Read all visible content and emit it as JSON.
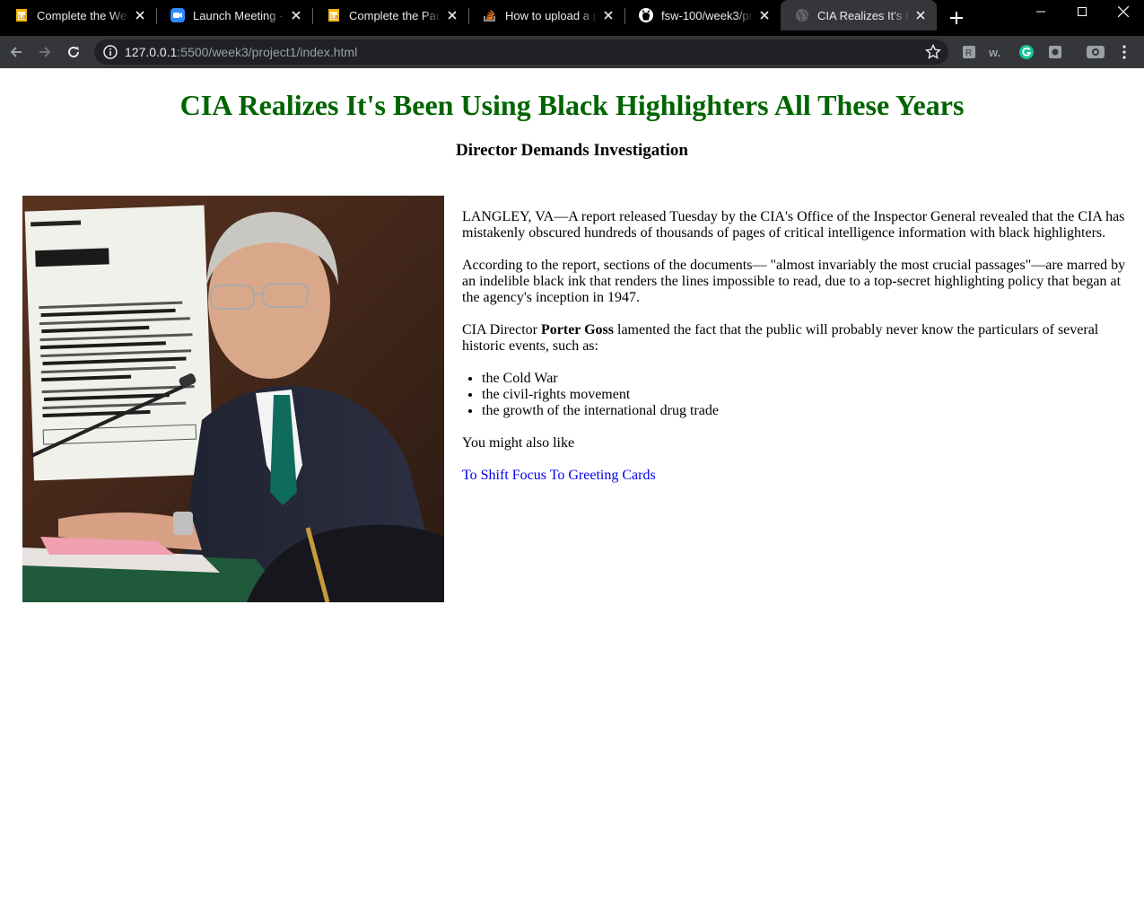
{
  "browser": {
    "tabs": [
      {
        "title": "Complete the Week 3",
        "favicon": "lambda-doc-icon",
        "active": false
      },
      {
        "title": "Launch Meeting - Zoom",
        "favicon": "zoom-icon",
        "active": false
      },
      {
        "title": "Complete the Pause",
        "favicon": "lambda-doc-icon",
        "active": false
      },
      {
        "title": "How to upload a pro",
        "favicon": "stackoverflow-icon",
        "active": false
      },
      {
        "title": "fsw-100/week3/proje",
        "favicon": "github-icon",
        "active": false
      },
      {
        "title": "CIA Realizes It's Been",
        "favicon": "globe-icon",
        "active": true
      }
    ],
    "address": {
      "host": "127.0.0.1",
      "rest": ":5500/week3/project1/index.html"
    },
    "colors": {
      "tabbar": "#000000",
      "toolbar": "#35363a",
      "omnibox": "#202124",
      "text": "#e8eaed"
    }
  },
  "article": {
    "headline": "CIA Realizes It's Been Using Black Highlighters All These Years",
    "subheadline": "Director Demands Investigation",
    "headline_color": "#006400",
    "paragraph1": "LANGLEY, VA—A report released Tuesday by the CIA's Office of the Inspector General revealed that the CIA has mistakenly obscured hundreds of thousands of pages of critical intelligence information with black highlighters.",
    "paragraph2": "According to the report, sections of the documents— \"almost invariably the most crucial passages\"—are marred by an indelible black ink that renders the lines impossible to read, due to a top-secret highlighting policy that began at the agency's inception in 1947.",
    "paragraph3_before": "CIA Director ",
    "paragraph3_bold": "Porter Goss",
    "paragraph3_after": " lamented the fact that the public will probably never know the particulars of several historic events, such as:",
    "events": [
      "the Cold War",
      "the civil-rights movement",
      "the growth of the international drug trade"
    ],
    "also_like_label": "You might also like",
    "link_text": "To Shift Focus To Greeting Cards",
    "link_color": "#0000ee"
  }
}
